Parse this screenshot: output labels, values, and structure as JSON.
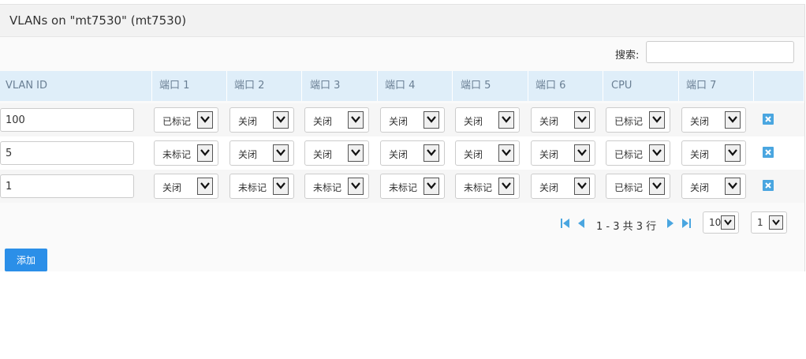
{
  "title": "VLANs on \"mt7530\" (mt7530)",
  "search": {
    "label": "搜索:",
    "value": ""
  },
  "columns": [
    "VLAN ID",
    "端口 1",
    "端口 2",
    "端口 3",
    "端口 4",
    "端口 5",
    "端口 6",
    "CPU",
    "端口 7"
  ],
  "rows": [
    {
      "vlan_id": "100",
      "ports": [
        "已标记",
        "关闭",
        "关闭",
        "关闭",
        "关闭",
        "关闭",
        "已标记",
        "关闭"
      ]
    },
    {
      "vlan_id": "5",
      "ports": [
        "未标记",
        "关闭",
        "关闭",
        "关闭",
        "关闭",
        "关闭",
        "已标记",
        "关闭"
      ]
    },
    {
      "vlan_id": "1",
      "ports": [
        "关闭",
        "未标记",
        "未标记",
        "未标记",
        "未标记",
        "关闭",
        "已标记",
        "关闭"
      ]
    }
  ],
  "pagination": {
    "summary": "1 - 3 共 3 行",
    "page_size": "10",
    "page": "1"
  },
  "add_label": "添加",
  "colors": {
    "header_bg": "#dfeef9",
    "accent": "#2b8fe8",
    "delete_icon": "#4aa6e0"
  }
}
